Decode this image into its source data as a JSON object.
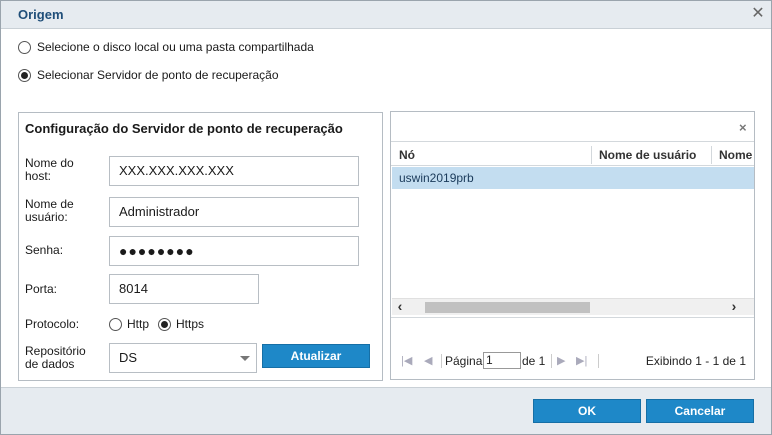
{
  "dialog": {
    "title": "Origem"
  },
  "source_options": [
    {
      "label": "Selecione o disco local ou uma pasta compartilhada",
      "selected": false
    },
    {
      "label": "Selecionar Servidor de ponto de recuperação",
      "selected": true
    }
  ],
  "config": {
    "title": "Configuração do Servidor de ponto de recuperação",
    "hostname_label_1": "Nome do",
    "hostname_label_2": "host:",
    "hostname_value": "XXX.XXX.XXX.XXX",
    "username_label_1": "Nome de",
    "username_label_2": "usuário:",
    "username_value": "Administrador",
    "password_label": "Senha:",
    "password_value": "●●●●●●●●",
    "port_label": "Porta:",
    "port_value": "8014",
    "protocol_label": "Protocolo:",
    "protocol_http": "Http",
    "protocol_https": "Https",
    "protocol_selected": "Https",
    "datastore_label_1": "Repositório",
    "datastore_label_2": "de dados",
    "datastore_value": "DS",
    "refresh_label": "Atualizar"
  },
  "grid": {
    "clear_icon": "×",
    "columns": [
      "Nó",
      "Nome de usuário",
      "Nome"
    ],
    "rows": [
      {
        "node": "uswin2019prb"
      }
    ],
    "pager": {
      "page_label": "Página",
      "page_value": "1",
      "of_label": "de 1",
      "summary": "Exibindo 1 - 1 de 1"
    }
  },
  "footer": {
    "ok_label": "OK",
    "cancel_label": "Cancelar"
  },
  "colors": {
    "accent": "#1e88c8",
    "title_text": "#1f4e79",
    "selected_row": "#c3ddf0"
  }
}
